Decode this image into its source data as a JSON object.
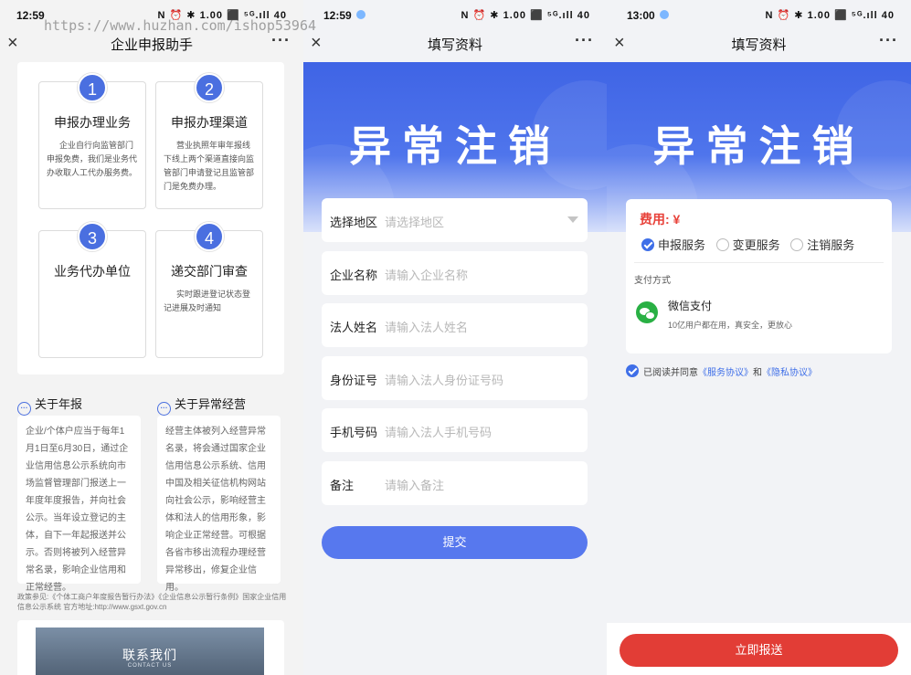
{
  "watermark": "https://www.huzhan.com/ishop53964",
  "status": {
    "p1_time": "12:59",
    "p2_time": "12:59",
    "p3_time": "13:00",
    "icons": "N ⏰ ✱ 1.00 ⬛ ⁵ᴳ.ıll 40"
  },
  "common": {
    "close": "×",
    "more": "···"
  },
  "p1": {
    "title": "企业申报助手",
    "cards": [
      {
        "num": "1",
        "title": "申报办理业务",
        "desc": "企业自行向监管部门申报免费，我们是业务代办收取人工代办服务费。"
      },
      {
        "num": "2",
        "title": "申报办理渠道",
        "desc": "营业执照年审年报线下线上两个渠道直接向监管部门申请登记且监管部门是免费办理。"
      },
      {
        "num": "3",
        "title": "业务代办单位",
        "desc": ""
      },
      {
        "num": "4",
        "title": "递交部门审查",
        "desc": "实时跟进登记状态登记进展及时通知"
      }
    ],
    "about_annual": {
      "title": "关于年报",
      "body": "企业/个体户应当于每年1月1日至6月30日，通过企业信用信息公示系统向市场监督管理部门报送上一年度年度报告，并向社会公示。当年设立登记的主体，自下一年起报送并公示。否则将被列入经营异常名录，影响企业信用和正常经营。"
    },
    "about_abnormal": {
      "title": "关于异常经营",
      "body": "经营主体被列入经营异常名录，将会通过国家企业信用信息公示系统、信用中国及相关征信机构网站向社会公示，影响经营主体和法人的信用形象，影响企业正常经营。可根据各省市移出流程办理经营异常移出，修复企业信用。"
    },
    "policy": "政策参见:《个体工商户年度报告暂行办法》《企业信息公示暂行条例》国家企业信用信息公示系统 官方地址:http://www.gsxt.gov.cn",
    "contact_title": "联系我们",
    "contact_sub": "CONTACT US"
  },
  "p2": {
    "title": "填写资料",
    "banner": "异常注销",
    "fields": [
      {
        "label": "选择地区",
        "placeholder": "请选择地区"
      },
      {
        "label": "企业名称",
        "placeholder": "请输入企业名称"
      },
      {
        "label": "法人姓名",
        "placeholder": "请输入法人姓名"
      },
      {
        "label": "身份证号",
        "placeholder": "请输入法人身份证号码"
      },
      {
        "label": "手机号码",
        "placeholder": "请输入法人手机号码"
      },
      {
        "label": "备注",
        "placeholder": "请输入备注"
      }
    ],
    "submit": "提交"
  },
  "p3": {
    "title": "填写资料",
    "banner": "异常注销",
    "fee": "费用: ¥",
    "options": [
      "申报服务",
      "变更服务",
      "注销服务"
    ],
    "selected_option": "申报服务",
    "pay_label": "支付方式",
    "pay_name": "微信支付",
    "pay_desc": "10亿用户都在用，真安全，更放心",
    "agree_pre": "已阅读并同意",
    "agree_link1": "《服务协议》",
    "agree_mid": "和",
    "agree_link2": "《隐私协议》",
    "report": "立即报送"
  },
  "colors": {
    "accent": "#4a6fe0",
    "danger": "#e23d36",
    "wechat": "#29b044"
  }
}
